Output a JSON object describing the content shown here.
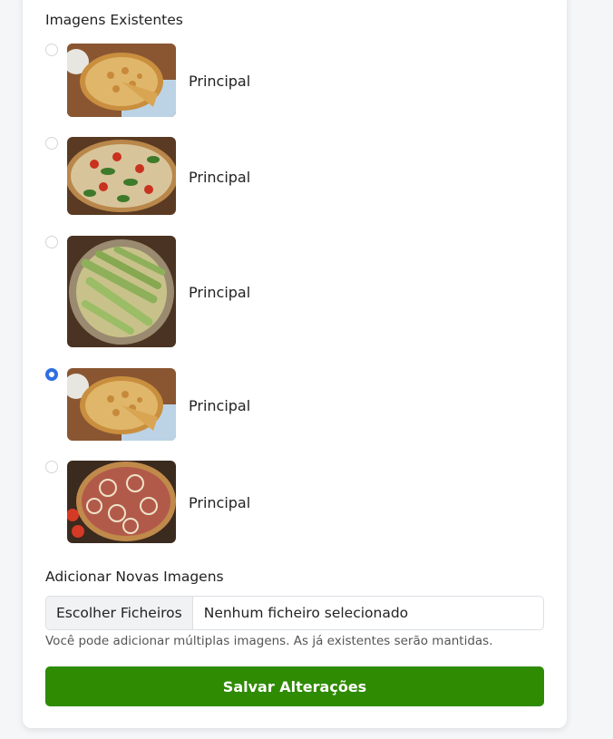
{
  "existing_images": {
    "heading": "Imagens Existentes",
    "items": [
      {
        "label": "Principal",
        "selected": false,
        "icon": "pizza-photo-icon"
      },
      {
        "label": "Principal",
        "selected": false,
        "icon": "pizza-photo-icon"
      },
      {
        "label": "Principal",
        "selected": false,
        "icon": "pizza-photo-icon"
      },
      {
        "label": "Principal",
        "selected": true,
        "icon": "pizza-photo-icon"
      },
      {
        "label": "Principal",
        "selected": false,
        "icon": "pizza-photo-icon"
      }
    ]
  },
  "new_images": {
    "heading": "Adicionar Novas Imagens",
    "choose_button": "Escolher Ficheiros",
    "status": "Nenhum ficheiro selecionado",
    "hint": "Você pode adicionar múltiplas imagens. As já existentes serão mantidas."
  },
  "actions": {
    "save_label": "Salvar Alterações"
  },
  "colors": {
    "accent_radio": "#2f6fe4",
    "save_button": "#2e8b02"
  }
}
